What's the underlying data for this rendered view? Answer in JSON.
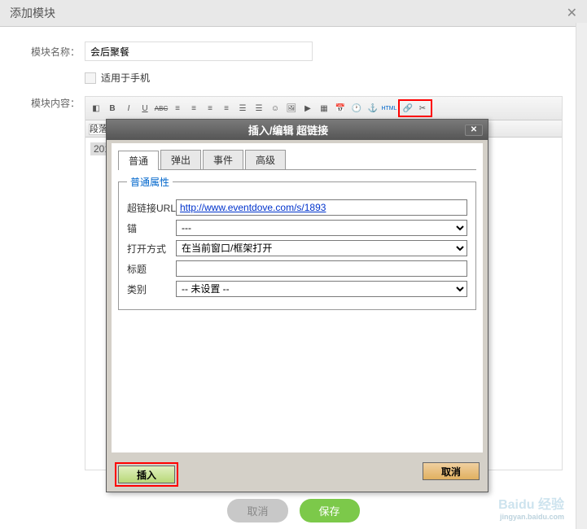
{
  "main": {
    "title": "添加模块",
    "name_label": "模块名称：",
    "name_value": "会后聚餐",
    "mobile_checkbox": "适用于手机",
    "content_label": "模块内容：",
    "format_label": "段落",
    "editor_text": "201"
  },
  "dialog": {
    "title": "插入/编辑 超链接",
    "tabs": [
      "普通",
      "弹出",
      "事件",
      "高级"
    ],
    "fieldset_title": "普通属性",
    "url_label": "超链接URL",
    "url_value": "http://www.eventdove.com/s/1893",
    "anchor_label": "锚",
    "anchor_value": "---",
    "target_label": "打开方式",
    "target_value": "在当前窗口/框架打开",
    "title_label": "标题",
    "title_value": "",
    "class_label": "类别",
    "class_value": "-- 未设置 --",
    "insert_btn": "插入",
    "cancel_btn": "取消"
  },
  "bottom": {
    "cancel": "取消",
    "save": "保存"
  },
  "watermark": {
    "text": "Baidu 经验",
    "sub": "jingyan.baidu.com"
  }
}
